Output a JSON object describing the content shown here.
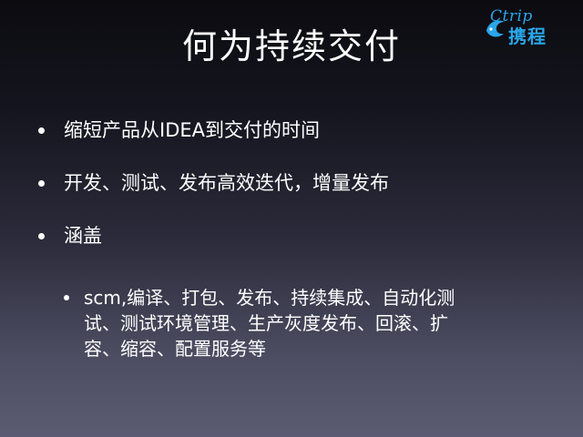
{
  "slide": {
    "title": "何为持续交付",
    "logo": {
      "brand": "Ctrip",
      "name_cn": "携程",
      "icon": "dolphin-logo-icon",
      "color": "#2aa6e8"
    },
    "bullets": [
      "缩短产品从IDEA到交付的时间",
      "开发、测试、发布高效迭代，增量发布",
      "涵盖"
    ],
    "sub_bullet_lines": [
      "scm,编译、打包、发布、持续集成、自动化测",
      "试、测试环境管理、生产灰度发布、回滚、扩",
      "容、缩容、配置服务等"
    ]
  }
}
